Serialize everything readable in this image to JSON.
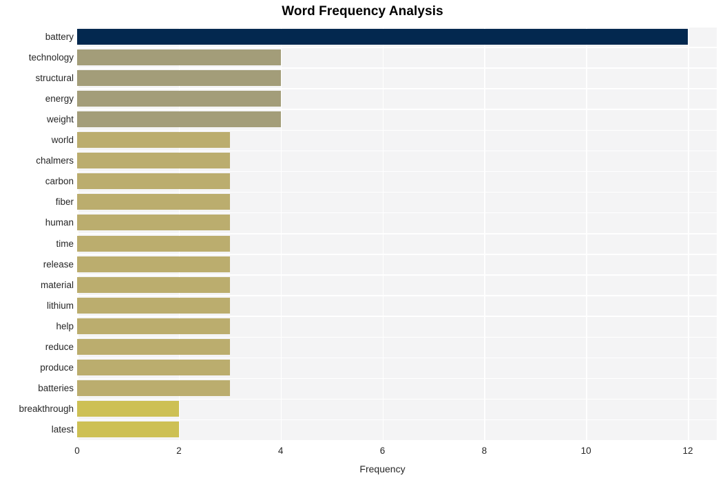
{
  "chart_data": {
    "type": "bar",
    "orientation": "horizontal",
    "title": "Word Frequency Analysis",
    "xlabel": "Frequency",
    "ylabel": "",
    "xlim": [
      0,
      12
    ],
    "xticks": [
      0,
      2,
      4,
      6,
      8,
      10,
      12
    ],
    "xtick_labels": [
      "0",
      "2",
      "4",
      "6",
      "8",
      "10",
      "12"
    ],
    "grid": true,
    "legend": null,
    "categories": [
      "battery",
      "technology",
      "structural",
      "energy",
      "weight",
      "world",
      "chalmers",
      "carbon",
      "fiber",
      "human",
      "time",
      "release",
      "material",
      "lithium",
      "help",
      "reduce",
      "produce",
      "batteries",
      "breakthrough",
      "latest"
    ],
    "values": [
      12,
      4,
      4,
      4,
      4,
      3,
      3,
      3,
      3,
      3,
      3,
      3,
      3,
      3,
      3,
      3,
      3,
      3,
      2,
      2
    ],
    "bar_colors": [
      "#03284f",
      "#a39d79",
      "#a39d79",
      "#a39d79",
      "#a39d79",
      "#bbad6e",
      "#bbad6e",
      "#bbad6e",
      "#bbad6e",
      "#bbad6e",
      "#bbad6e",
      "#bbad6e",
      "#bbad6e",
      "#bbad6e",
      "#bbad6e",
      "#bbad6e",
      "#bbad6e",
      "#bbad6e",
      "#cdc054",
      "#cdc054"
    ],
    "plot_background": "#f4f4f5",
    "grid_color": "#ffffff",
    "figure_background": "#ffffff"
  }
}
